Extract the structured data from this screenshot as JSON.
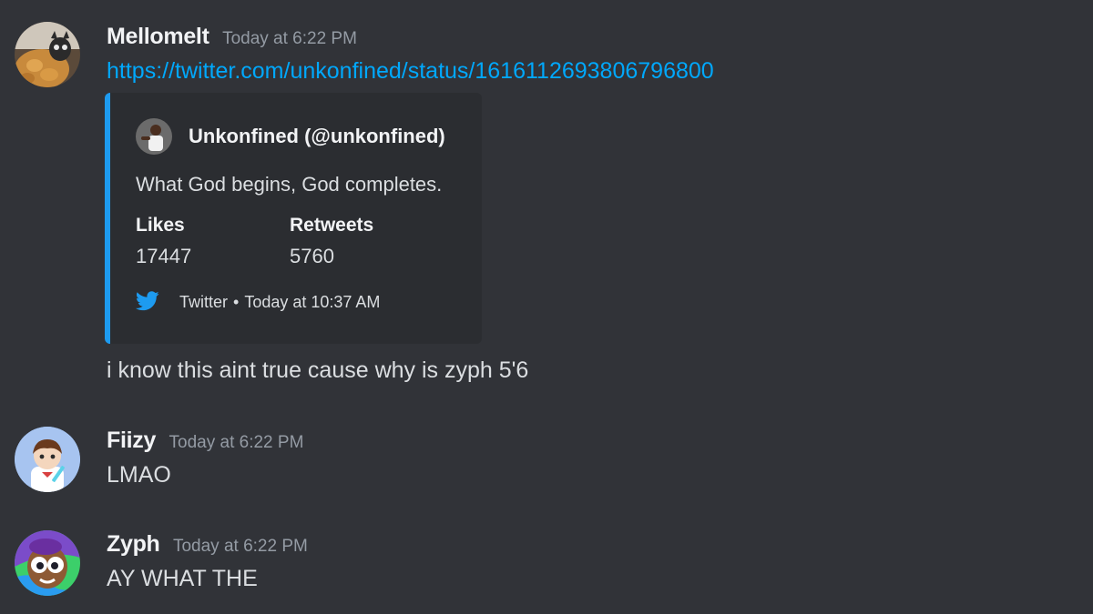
{
  "messages": [
    {
      "username": "Mellomelt",
      "timestamp": "Today at 6:22 PM",
      "link": "https://twitter.com/unkonfined/status/1616112693806796800",
      "embed": {
        "author": "Unkonfined (@unkonfined)",
        "description": "What God begins, God completes.",
        "fields": [
          {
            "name": "Likes",
            "value": "17447"
          },
          {
            "name": "Retweets",
            "value": "5760"
          }
        ],
        "footer_source": "Twitter",
        "footer_separator": "•",
        "footer_time": "Today at 10:37 AM",
        "accent_color": "#1d9bf0"
      },
      "text": "i know this aint true cause why is zyph 5'6"
    },
    {
      "username": "Fiizy",
      "timestamp": "Today at 6:22 PM",
      "text": "LMAO"
    },
    {
      "username": "Zyph",
      "timestamp": "Today at 6:22 PM",
      "text": "AY WHAT THE"
    }
  ],
  "icons": {
    "embed_footer": "twitter-bird-icon"
  },
  "colors": {
    "background": "#313338",
    "embed_background": "#2b2d31",
    "link": "#00a8fc",
    "timestamp": "#949ba4"
  }
}
